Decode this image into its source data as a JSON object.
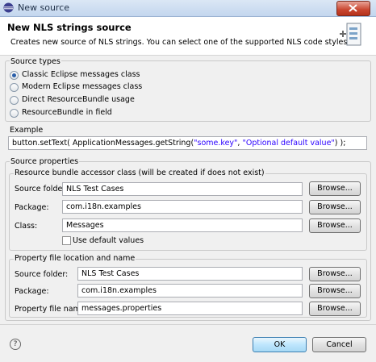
{
  "window": {
    "title": "New source"
  },
  "header": {
    "title": "New NLS strings source",
    "description": "Creates new source of NLS strings. You can select one of the supported NLS code styles."
  },
  "source_types": {
    "label": "Source types",
    "options": [
      {
        "label": "Classic Eclipse messages class",
        "selected": true
      },
      {
        "label": "Modern Eclipse messages class",
        "selected": false
      },
      {
        "label": "Direct ResourceBundle usage",
        "selected": false
      },
      {
        "label": "ResourceBundle in field",
        "selected": false
      }
    ]
  },
  "example": {
    "label": "Example",
    "code_prefix": "button.setText( ApplicationMessages.getString(",
    "code_key": "\"some.key\"",
    "code_sep": ", ",
    "code_default": "\"Optional default value\"",
    "code_suffix": ") );"
  },
  "source_properties": {
    "label": "Source properties",
    "accessor": {
      "label": "Resource bundle accessor class (will be created if does not exist)",
      "source_folder_label": "Source folder:",
      "source_folder_value": "NLS Test Cases",
      "package_label": "Package:",
      "package_value": "com.i18n.examples",
      "class_label": "Class:",
      "class_value": "Messages",
      "default_values_label": "Use default values"
    },
    "property_file": {
      "label": "Property file location and name",
      "source_folder_label": "Source folder:",
      "source_folder_value": "NLS Test Cases",
      "package_label": "Package:",
      "package_value": "com.i18n.examples",
      "file_name_label": "Property file name:",
      "file_name_value": "messages.properties"
    },
    "browse_label": "Browse..."
  },
  "buttons": {
    "ok": "OK",
    "cancel": "Cancel",
    "help_icon": "?"
  }
}
